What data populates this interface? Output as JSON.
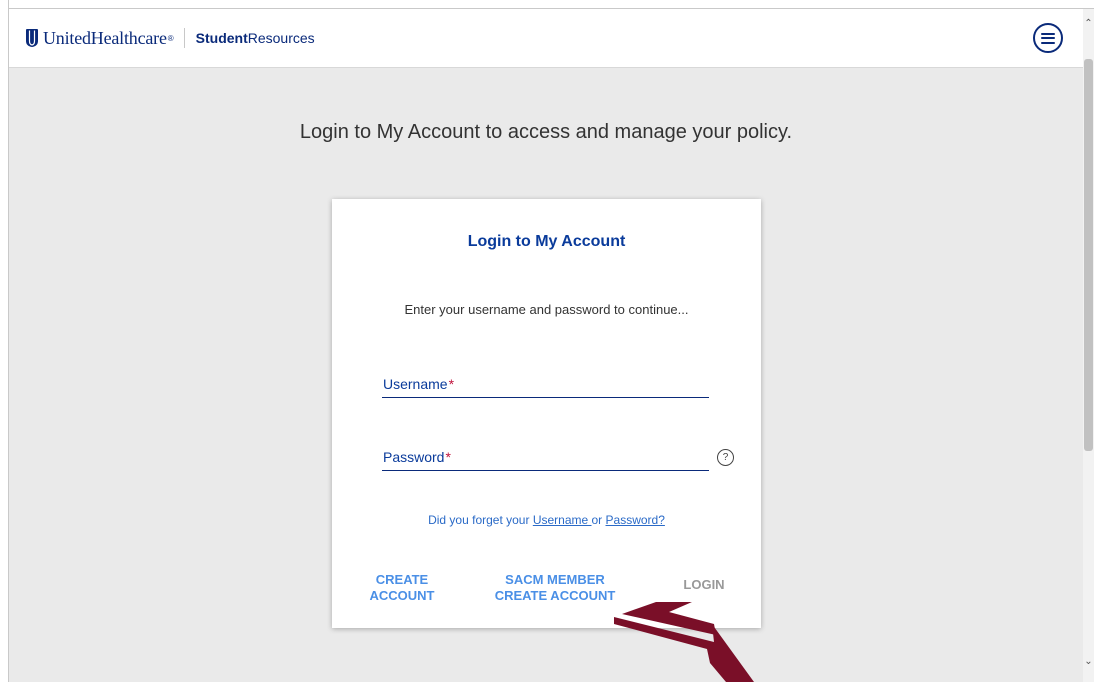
{
  "header": {
    "brand": "UnitedHealthcare",
    "brand_reg": "®",
    "sub_bold": "Student",
    "sub_light": "Resources"
  },
  "main": {
    "intro": "Login to My Account to access and manage your policy."
  },
  "card": {
    "title": "Login to My Account",
    "description": "Enter your username and password to continue...",
    "username_label": "Username",
    "password_label": "Password",
    "required_marker": "*",
    "help_icon": "?",
    "forgot_prefix": "Did you forget your ",
    "forgot_username": "Username ",
    "forgot_or": "or ",
    "forgot_password": "Password?",
    "create_line1": "CREATE",
    "create_line2": "ACCOUNT",
    "sacm_line1": "SACM MEMBER",
    "sacm_line2": "CREATE ACCOUNT",
    "login": "LOGIN"
  },
  "colors": {
    "brand_blue": "#0a2a7a",
    "title_blue": "#0a3b9b",
    "link_blue": "#2a6ac7",
    "button_blue": "#4a8fe6",
    "required_red": "#c0143c",
    "background_gray": "#eaeaea",
    "arrow_maroon": "#7a0f28"
  },
  "icons": {
    "menu": "hamburger-menu-icon",
    "help": "question-circle-icon",
    "logo": "shield-logo-icon",
    "arrow": "pointer-arrow-icon"
  }
}
